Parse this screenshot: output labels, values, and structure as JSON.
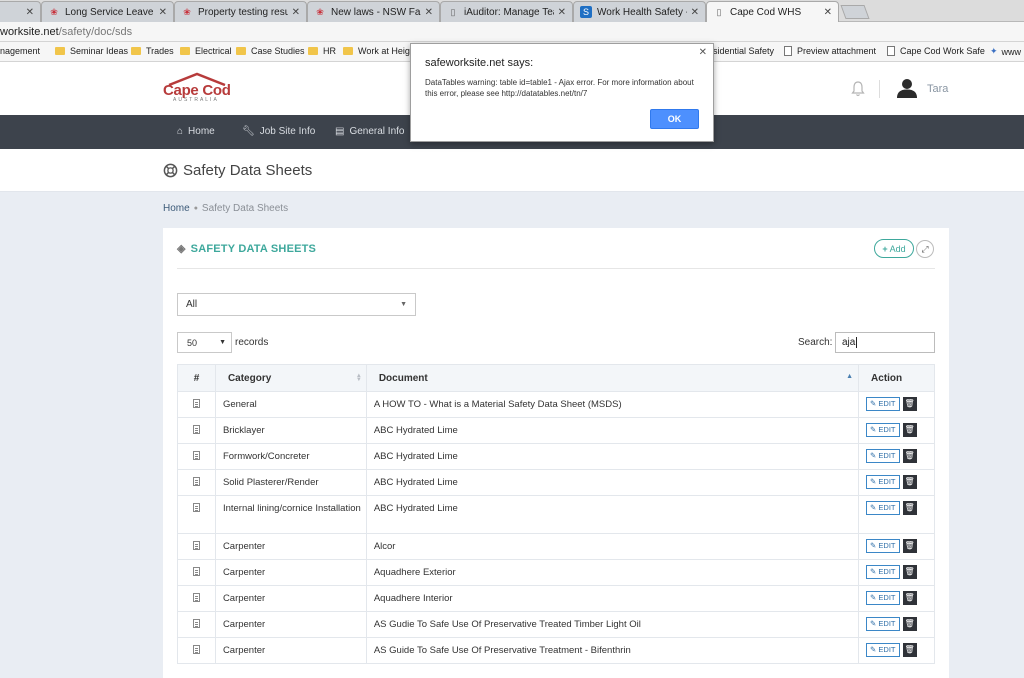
{
  "browser": {
    "tabs": [
      {
        "title": "Long Service Leave - A gu",
        "favicon": "nsw-gov-icon"
      },
      {
        "title": "Property testing results -",
        "favicon": "nsw-gov-icon"
      },
      {
        "title": "New laws - NSW Fair Trad",
        "favicon": "nsw-gov-icon"
      },
      {
        "title": "iAuditor: Manage Teams",
        "favicon": "page-icon"
      },
      {
        "title": "Work Health Safety - All",
        "favicon": "safework-icon"
      },
      {
        "title": "Cape Cod WHS",
        "favicon": "page-icon"
      }
    ],
    "close_glyph": "✕",
    "address_host": "worksite.net",
    "address_path": "/safety/doc/sds",
    "bookmarks": [
      {
        "label": "nagement"
      },
      {
        "label": "Seminar Ideas"
      },
      {
        "label": "Trades"
      },
      {
        "label": "Electrical"
      },
      {
        "label": "Case Studies"
      },
      {
        "label": "HR"
      },
      {
        "label": "Work at Heigh"
      },
      {
        "label": "esidential Safety"
      },
      {
        "label": "Preview attachment"
      },
      {
        "label": "Cape Cod Work Safe"
      },
      {
        "label": "www"
      }
    ]
  },
  "header": {
    "logo_text": "Cape Cod",
    "logo_subtext": "AUSTRALIA",
    "user_name": "Tara"
  },
  "nav": {
    "items": [
      {
        "label": "Home",
        "icon": "home-icon"
      },
      {
        "label": "Job Site Info",
        "icon": "wrench-icon"
      },
      {
        "label": "General Info",
        "icon": "file-icon"
      }
    ]
  },
  "page": {
    "title": "Safety Data Sheets",
    "breadcrumb": {
      "home": "Home",
      "current": "Safety Data Sheets"
    }
  },
  "card": {
    "title": "SAFETY DATA SHEETS",
    "add_label": "Add",
    "filter_value": "All",
    "page_length": "50",
    "records_label": "records",
    "search_label": "Search:",
    "search_value": "aja"
  },
  "table": {
    "headers": {
      "num": "#",
      "category": "Category",
      "document": "Document",
      "action": "Action"
    },
    "edit_label": "EDIT",
    "rows": [
      {
        "category": "General",
        "document": "A HOW TO - What is a Material Safety Data Sheet (MSDS)"
      },
      {
        "category": "Bricklayer",
        "document": "ABC Hydrated Lime"
      },
      {
        "category": "Formwork/Concreter",
        "document": "ABC Hydrated Lime"
      },
      {
        "category": "Solid Plasterer/Render",
        "document": "ABC Hydrated Lime"
      },
      {
        "category": "Internal lining/cornice Installation",
        "document": "ABC Hydrated Lime"
      },
      {
        "category": "Carpenter",
        "document": "Alcor"
      },
      {
        "category": "Carpenter",
        "document": "Aquadhere Exterior"
      },
      {
        "category": "Carpenter",
        "document": "Aquadhere Interior"
      },
      {
        "category": "Carpenter",
        "document": "AS Gudie To Safe Use Of Preservative Treated Timber Light Oil"
      },
      {
        "category": "Carpenter",
        "document": "AS Guide To Safe Use Of Preservative Treatment - Bifenthrin"
      }
    ]
  },
  "dialog": {
    "title": "safeworksite.net says:",
    "message": "DataTables warning: table id=table1 - Ajax error. For more information about this error, please see http://datatables.net/tn/7",
    "ok_label": "OK"
  },
  "colors": {
    "accent_teal": "#3ea89c",
    "nav_bg": "#3d434c",
    "logo_red": "#b73b3b",
    "ok_blue": "#4d90fe"
  }
}
